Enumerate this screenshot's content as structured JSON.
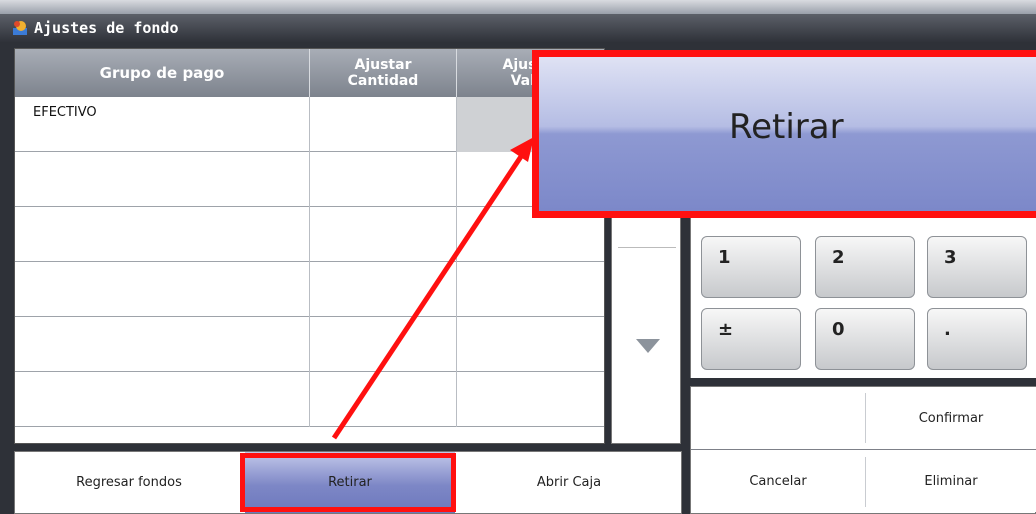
{
  "window": {
    "title": "Ajustes de fondo"
  },
  "grid": {
    "headers": {
      "group": "Grupo de pago",
      "qty_line1": "Ajustar",
      "qty_line2": "Cantidad",
      "val_line1": "Ajustar",
      "val_line2": "Valor"
    },
    "rows": [
      {
        "group": "EFECTIVO",
        "qty": "",
        "val": ""
      },
      {
        "group": "",
        "qty": "",
        "val": ""
      },
      {
        "group": "",
        "qty": "",
        "val": ""
      },
      {
        "group": "",
        "qty": "",
        "val": ""
      },
      {
        "group": "",
        "qty": "",
        "val": ""
      },
      {
        "group": "",
        "qty": "",
        "val": ""
      }
    ]
  },
  "keypad": {
    "keys": [
      "1",
      "2",
      "3",
      "±",
      "0",
      "."
    ]
  },
  "actions": {
    "regresar": "Regresar fondos",
    "retirar": "Retirar",
    "abrir": "Abrir Caja",
    "confirmar": "Confirmar",
    "cancelar": "Cancelar",
    "eliminar": "Eliminar"
  },
  "callout": {
    "label": "Retirar"
  },
  "colors": {
    "highlight": "#ff1010",
    "active_button": "#7d87c6"
  }
}
